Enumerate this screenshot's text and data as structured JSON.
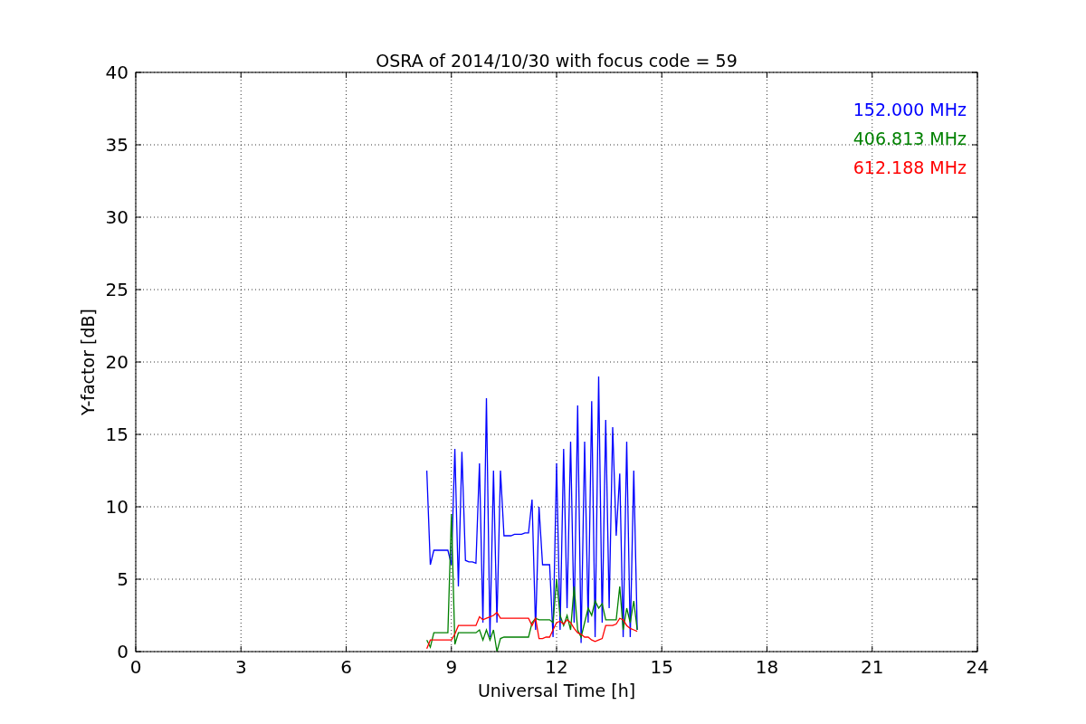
{
  "figure": {
    "chart_data": {
      "type": "line",
      "grid": true,
      "title": "OSRA of 2014/10/30 with focus code = 59",
      "xlabel": "Universal Time [h]",
      "ylabel": "Y-factor [dB]",
      "xlim": [
        0,
        24
      ],
      "ylim": [
        0,
        40
      ],
      "xticks": [
        0,
        3,
        6,
        9,
        12,
        15,
        18,
        21,
        24
      ],
      "yticks": [
        0,
        5,
        10,
        15,
        20,
        25,
        30,
        35,
        40
      ],
      "x": [
        8.3,
        8.4,
        8.5,
        8.6,
        8.7,
        8.8,
        8.9,
        9.0,
        9.1,
        9.2,
        9.3,
        9.4,
        9.5,
        9.6,
        9.7,
        9.8,
        9.9,
        10.0,
        10.1,
        10.2,
        10.3,
        10.4,
        10.5,
        10.6,
        10.7,
        10.8,
        10.9,
        11.0,
        11.1,
        11.2,
        11.3,
        11.4,
        11.5,
        11.6,
        11.7,
        11.8,
        11.9,
        12.0,
        12.1,
        12.2,
        12.3,
        12.4,
        12.5,
        12.6,
        12.7,
        12.8,
        12.9,
        13.0,
        13.1,
        13.2,
        13.3,
        13.4,
        13.5,
        13.6,
        13.7,
        13.8,
        13.9,
        14.0,
        14.1,
        14.2,
        14.3
      ],
      "series": [
        {
          "name": "152.000 MHz",
          "color": "#0000ff",
          "values": [
            12.5,
            6,
            7,
            7,
            7,
            7,
            7,
            6,
            14,
            4.5,
            13.8,
            6.3,
            6.2,
            6.2,
            6.1,
            13,
            2,
            17.5,
            1,
            12.5,
            2,
            12.5,
            8,
            8,
            8,
            8.1,
            8.1,
            8.1,
            8.2,
            8.2,
            10.5,
            1.5,
            10,
            6,
            6,
            6,
            1,
            13,
            1.5,
            14,
            3,
            14.5,
            2,
            17,
            0.6,
            14.5,
            2,
            17.3,
            1,
            19,
            2,
            16,
            3,
            15.5,
            8,
            12.3,
            1,
            14.5,
            1,
            12.5,
            1.5
          ]
        },
        {
          "name": "406.813 MHz",
          "color": "#008000",
          "values": [
            0.8,
            0.3,
            1.3,
            1.3,
            1.3,
            1.3,
            1.3,
            9.5,
            0.5,
            1.3,
            1.3,
            1.3,
            1.3,
            1.3,
            1.3,
            1.5,
            0.8,
            1.5,
            0.8,
            1.5,
            0,
            0.9,
            1,
            1,
            1,
            1,
            1,
            1,
            1,
            1,
            2,
            2.3,
            2.2,
            2.2,
            2.2,
            2.2,
            2,
            5,
            2.5,
            1.8,
            2.5,
            1.5,
            4.5,
            1.5,
            1,
            2,
            3,
            2.5,
            3.5,
            3,
            3.3,
            2.2,
            2.2,
            2.2,
            2.2,
            4.5,
            1.5,
            3,
            2,
            3.5,
            1.5
          ]
        },
        {
          "name": "612.188 MHz",
          "color": "#ff0000",
          "values": [
            0.2,
            0.8,
            0.8,
            0.8,
            0.8,
            0.8,
            0.8,
            0.8,
            1.2,
            1.8,
            1.8,
            1.8,
            1.8,
            1.8,
            1.8,
            2.4,
            2.2,
            2.3,
            2.4,
            2.5,
            2.7,
            2.3,
            2.3,
            2.3,
            2.3,
            2.3,
            2.3,
            2.3,
            2.3,
            2.3,
            1.8,
            2.3,
            0.9,
            0.9,
            1,
            1,
            1.5,
            2,
            2.1,
            1.9,
            2.2,
            2,
            1.6,
            1.3,
            1.2,
            1,
            1,
            0.8,
            0.7,
            0.8,
            0.9,
            1.8,
            1.8,
            1.8,
            1.9,
            2.3,
            2.2,
            1.8,
            1.6,
            1.5,
            1.4
          ]
        }
      ]
    }
  }
}
